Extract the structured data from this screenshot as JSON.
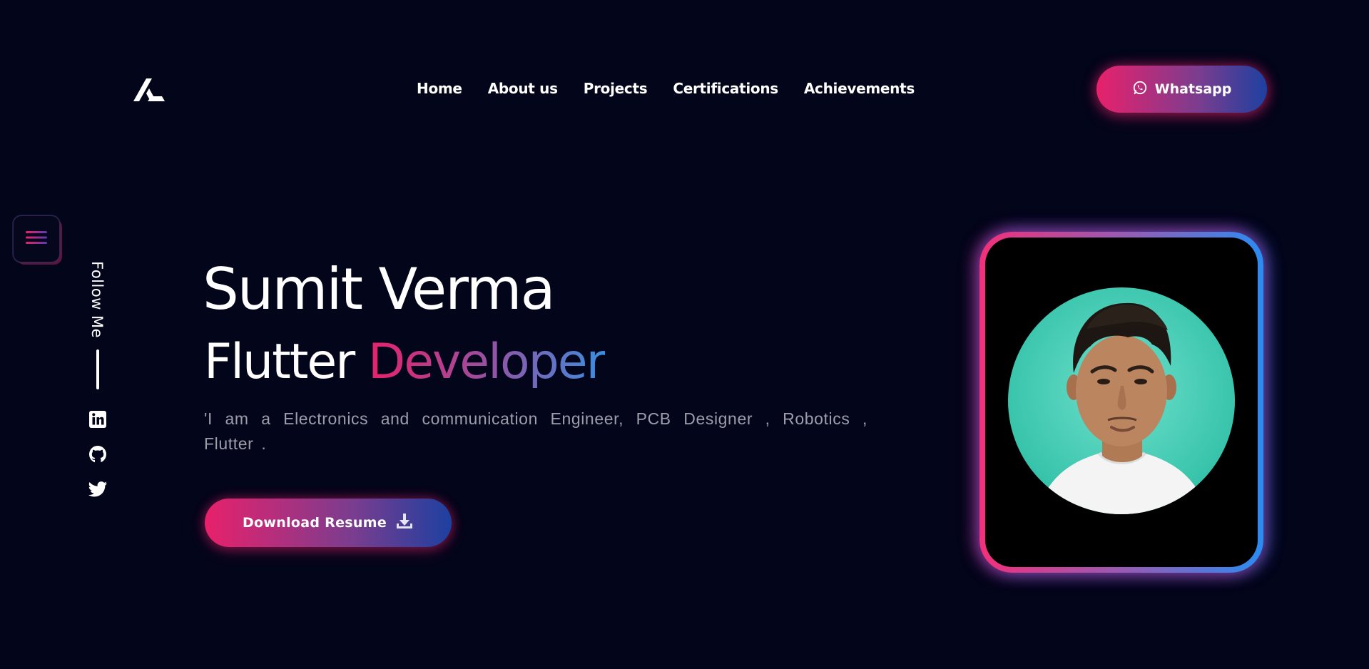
{
  "nav": {
    "items": [
      {
        "label": "Home"
      },
      {
        "label": "About us"
      },
      {
        "label": "Projects"
      },
      {
        "label": "Certifications"
      },
      {
        "label": "Achievements"
      }
    ]
  },
  "header": {
    "logo_icon": "stylized-a-logo-icon",
    "cta_label": "Whatsapp",
    "cta_icon": "whatsapp-icon"
  },
  "side": {
    "menu_icon": "hamburger-menu-icon",
    "follow_label": "Follow Me",
    "social": [
      {
        "icon": "linkedin-icon"
      },
      {
        "icon": "github-icon"
      },
      {
        "icon": "twitter-icon"
      }
    ]
  },
  "hero": {
    "name": "Sumit Verma",
    "role_prefix": "Flutter",
    "role_accent": "Developer",
    "description": "'I am a Electronics and communication Engineer, PCB Designer , Robotics , Flutter .",
    "resume_label": "Download Resume",
    "resume_icon": "download-icon"
  },
  "profile": {
    "photo": "profile-photo"
  },
  "colors": {
    "background": "#03051a",
    "accent_pink": "#e8216b",
    "accent_blue": "#1d40a0",
    "accent_light_blue": "#2a8cf3",
    "avatar_bg": "#3fcdb4",
    "description_text": "#9d9eaa"
  }
}
